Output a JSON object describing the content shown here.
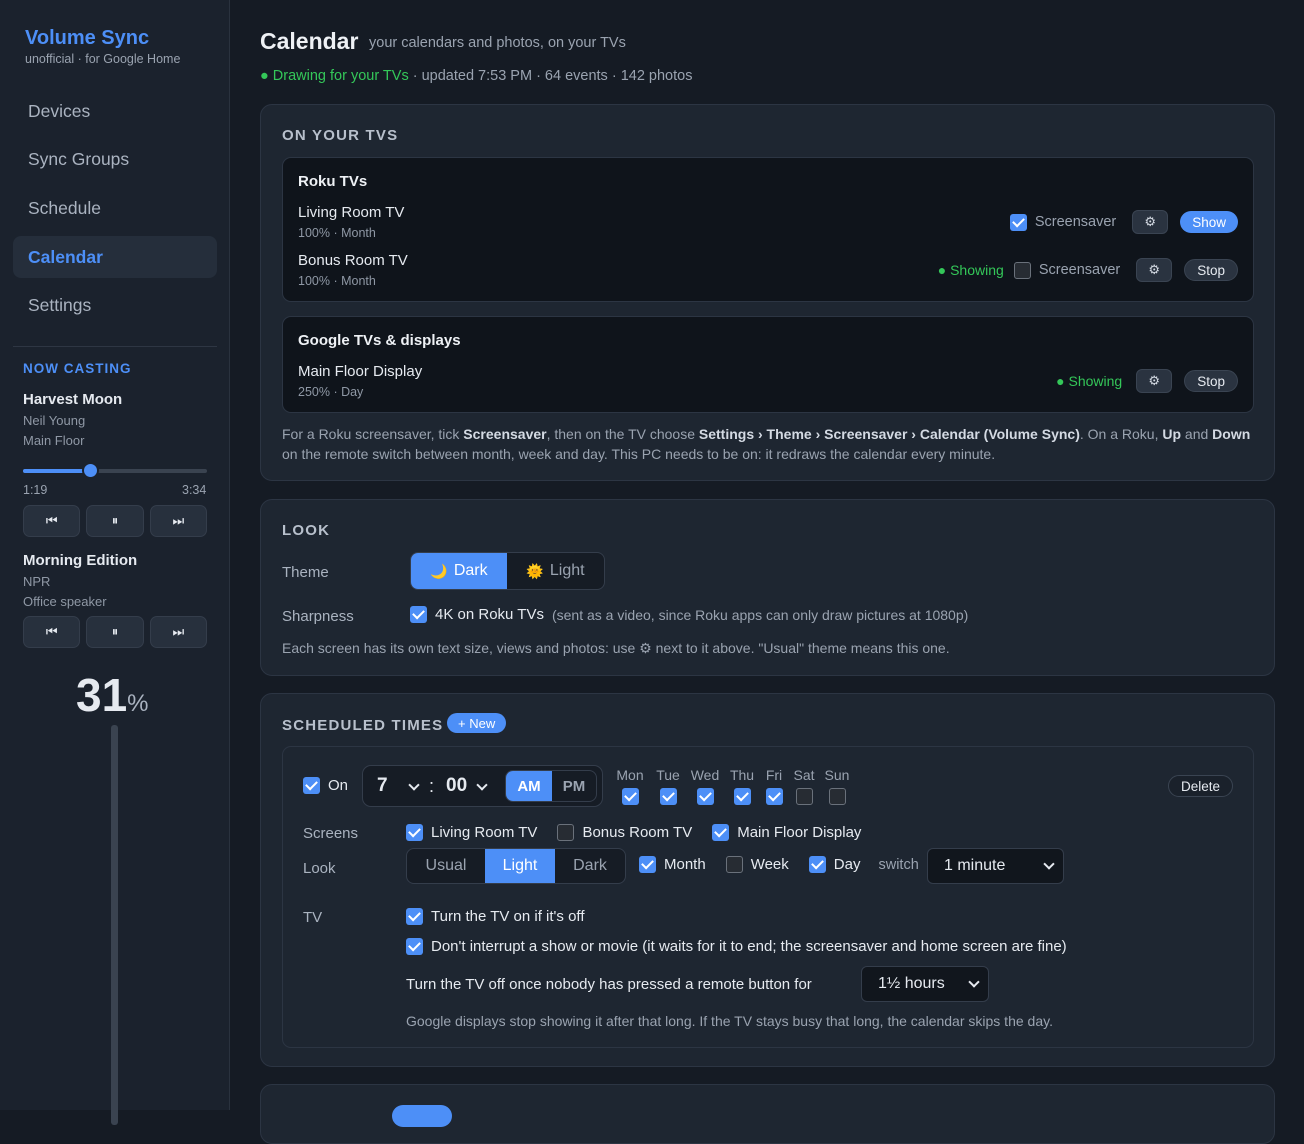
{
  "app": {
    "name": "Volume Sync",
    "subtitle": "unofficial · for Google Home"
  },
  "nav": [
    {
      "label": "Devices",
      "active": false
    },
    {
      "label": "Sync Groups",
      "active": false
    },
    {
      "label": "Schedule",
      "active": false
    },
    {
      "label": "Calendar",
      "active": true
    },
    {
      "label": "Settings",
      "active": false
    }
  ],
  "now_casting": {
    "heading": "NOW CASTING",
    "items": [
      {
        "title": "Harvest Moon",
        "artist": "Neil Young",
        "device": "Main Floor",
        "elapsed": "1:19",
        "duration": "3:34",
        "progress": 0.37
      },
      {
        "title": "Morning Edition",
        "artist": "NPR",
        "device": "Office speaker"
      }
    ],
    "controls": {
      "prev": "⏮",
      "pause": "⏸",
      "next": "⏭"
    },
    "volume": {
      "value": "31",
      "unit": "%"
    }
  },
  "header": {
    "title": "Calendar",
    "subtitle": "your calendars and photos, on your TVs",
    "status_dot": "●",
    "status_live": "Drawing for your TVs",
    "status_rest": " · updated 7:53 PM · 64 events · 142 photos"
  },
  "on_tvs": {
    "heading": "ON YOUR TVS",
    "gear": "⚙",
    "roku": {
      "title": "Roku TVs",
      "devices": [
        {
          "name": "Living Room TV",
          "sub": "100% · Month",
          "screensaver_label": "Screensaver",
          "screensaver": true,
          "button": "Show"
        },
        {
          "name": "Bonus Room TV",
          "sub": "100% · Month",
          "showing": "● Showing",
          "screensaver_label": "Screensaver",
          "screensaver": false,
          "button": "Stop"
        }
      ]
    },
    "google": {
      "title": "Google TVs & displays",
      "devices": [
        {
          "name": "Main Floor Display",
          "sub": "250% · Day",
          "showing": "● Showing",
          "button": "Stop"
        }
      ]
    },
    "help": {
      "p1": "For a Roku screensaver, tick ",
      "b1": "Screensaver",
      "p2": ", then on the TV choose ",
      "b2": "Settings › Theme › Screensaver › Calendar (Volume Sync)",
      "p3": ". On a Roku, ",
      "b3": "Up",
      "p4": " and ",
      "b4": "Down",
      "p5": " on the remote switch between month, week and day. This PC needs to be on: it redraws the calendar every minute."
    }
  },
  "look": {
    "heading": "LOOK",
    "theme_label": "Theme",
    "theme_options": [
      {
        "icon": "🌙",
        "label": "Dark",
        "selected": true
      },
      {
        "icon": "🌞",
        "label": "Light",
        "selected": false
      }
    ],
    "sharpness_label": "Sharpness",
    "sharpness_option": "4K on Roku TVs",
    "sharpness_note": "(sent as a video, since Roku apps can only draw pictures at 1080p)",
    "sharpness_checked": true,
    "note": "Each screen has its own text size, views and photos: use ⚙ next to it above. \"Usual\" theme means this one."
  },
  "scheduled": {
    "heading": "SCHEDULED TIMES",
    "new_button": "+ New",
    "entry": {
      "on_label": "On",
      "enabled": true,
      "hour": "7",
      "separator": ":",
      "minute": "00",
      "ampm": [
        {
          "label": "AM",
          "selected": true
        },
        {
          "label": "PM",
          "selected": false
        }
      ],
      "days": [
        {
          "label": "Mon",
          "checked": true
        },
        {
          "label": "Tue",
          "checked": true
        },
        {
          "label": "Wed",
          "checked": true
        },
        {
          "label": "Thu",
          "checked": true
        },
        {
          "label": "Fri",
          "checked": true
        },
        {
          "label": "Sat",
          "checked": false
        },
        {
          "label": "Sun",
          "checked": false
        }
      ],
      "delete": "Delete",
      "screens_label": "Screens",
      "screens": [
        {
          "label": "Living Room TV",
          "checked": true
        },
        {
          "label": "Bonus Room TV",
          "checked": false
        },
        {
          "label": "Main Floor Display",
          "checked": true
        }
      ],
      "look_label": "Look",
      "look_themes": [
        {
          "label": "Usual",
          "selected": false
        },
        {
          "label": "Light",
          "selected": true
        },
        {
          "label": "Dark",
          "selected": false
        }
      ],
      "views": [
        {
          "label": "Month",
          "checked": true
        },
        {
          "label": "Week",
          "checked": false
        },
        {
          "label": "Day",
          "checked": true
        }
      ],
      "switch_label": "switch",
      "switch_value": "1 minute",
      "tv_label": "TV",
      "turn_on": "Turn the TV on if it's off",
      "turn_on_checked": true,
      "no_interrupt": "Don't interrupt a show or movie (it waits for it to end; the screensaver and home screen are fine)",
      "no_interrupt_checked": true,
      "turn_off_label": "Turn the TV off once nobody has pressed a remote button for",
      "turn_off_value": "1½ hours",
      "footnote": "Google displays stop showing it after that long. If the TV stays busy that long, the calendar skips the day."
    }
  },
  "colors": {
    "accent": "#4d8ff7",
    "success": "#34c759",
    "background": "#151b24",
    "card": "#1e2631"
  }
}
